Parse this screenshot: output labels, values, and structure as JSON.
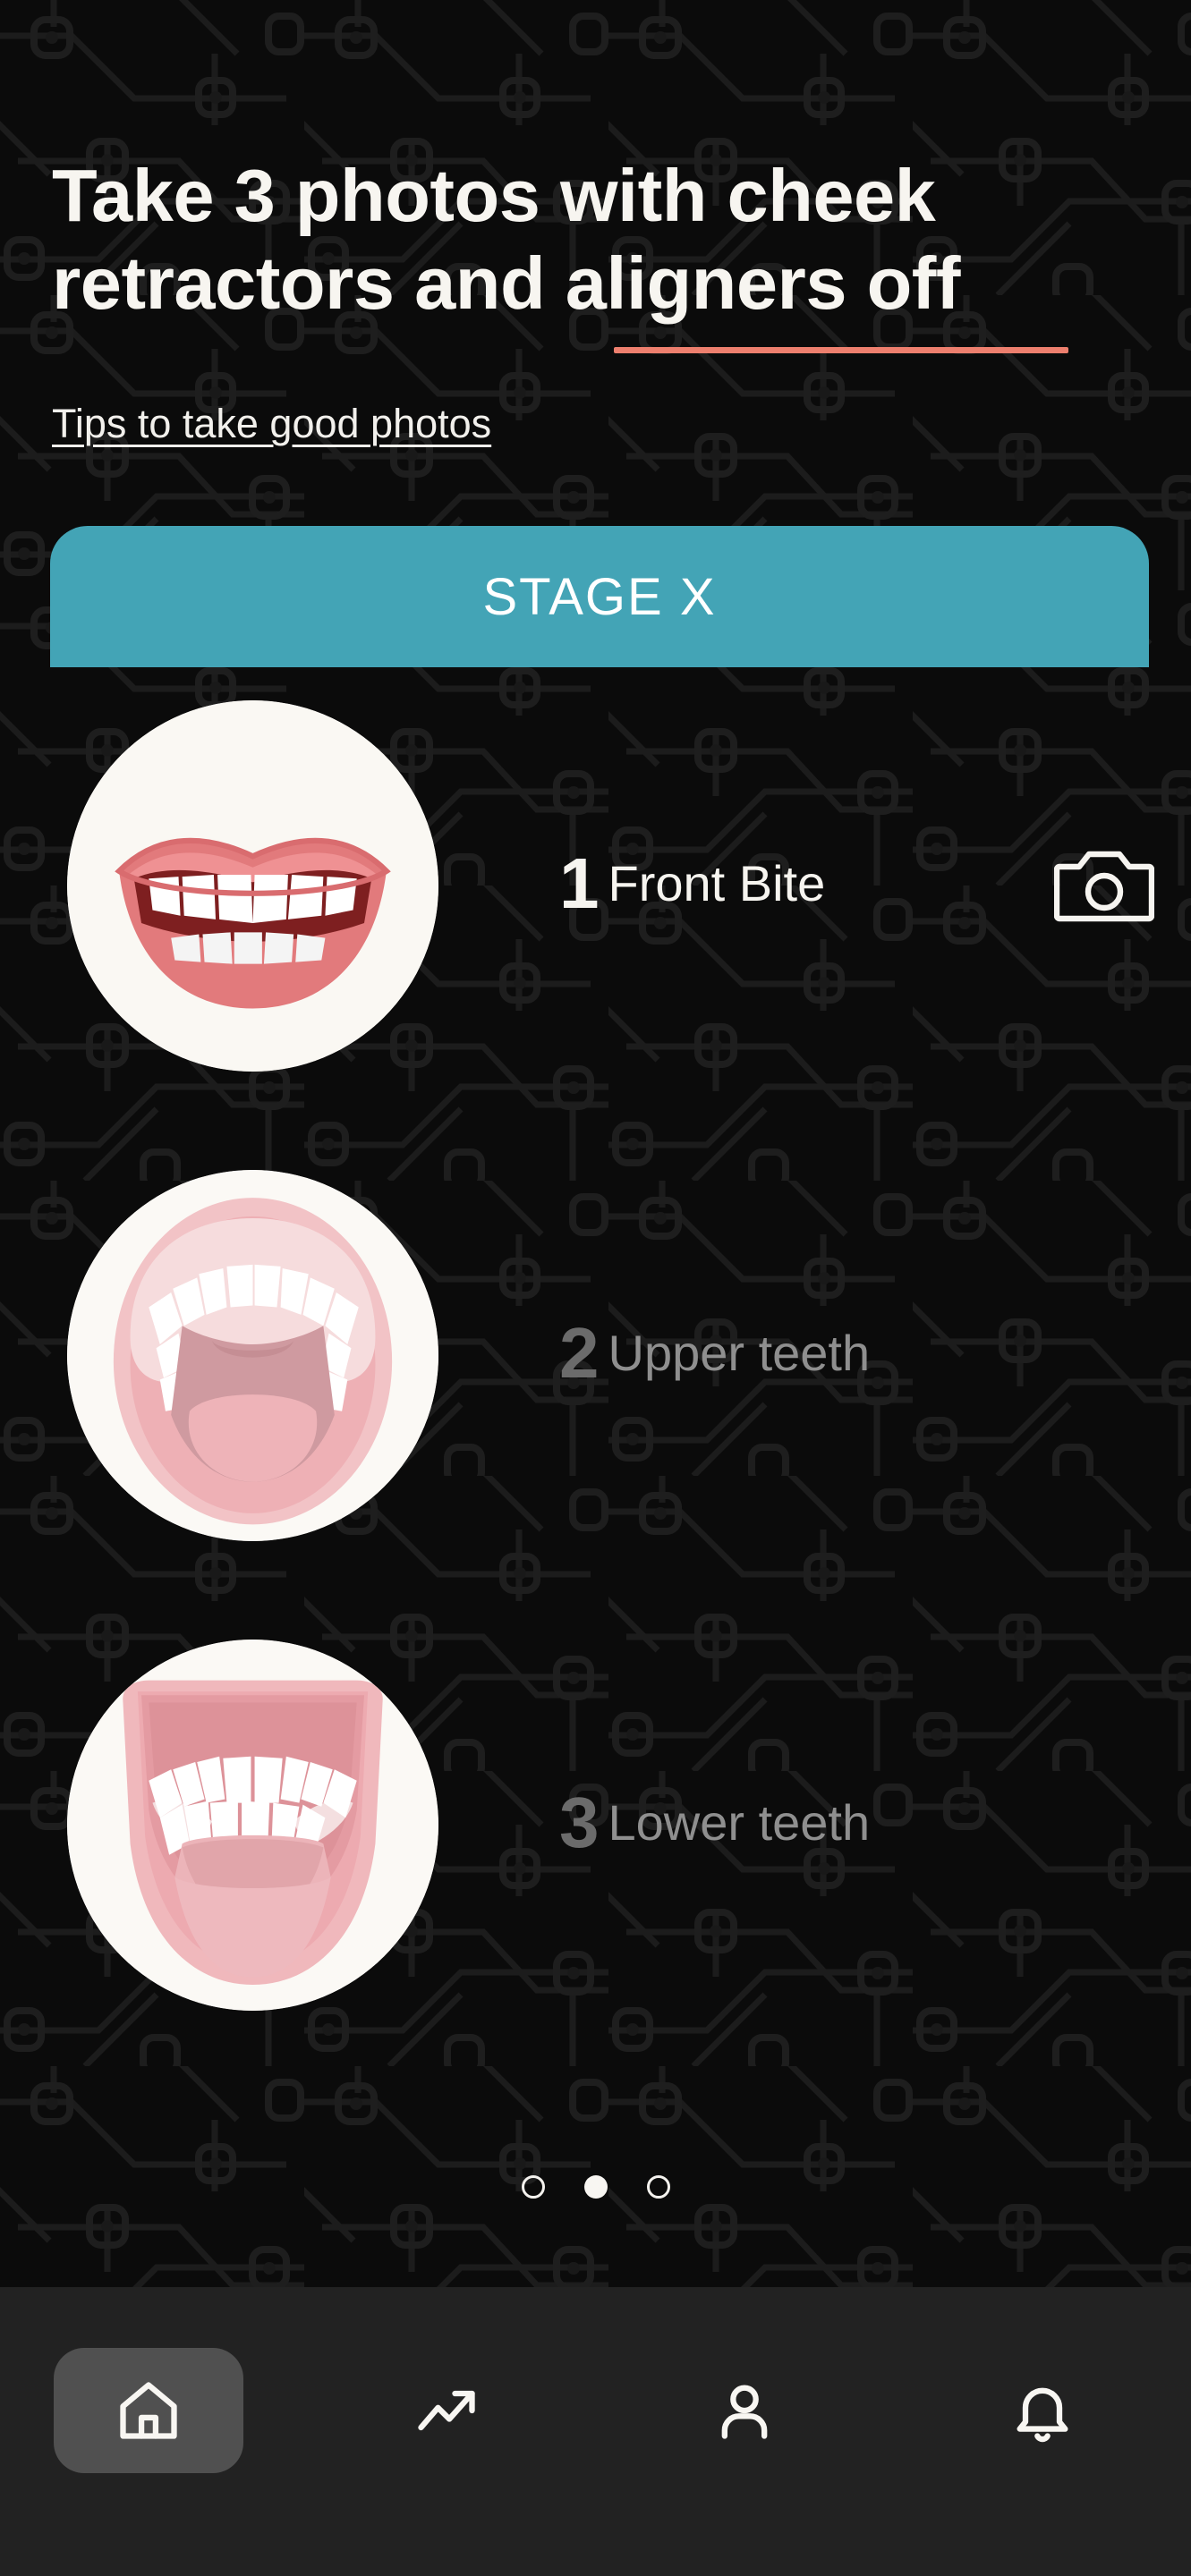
{
  "header": {
    "title": "Take 3 photos with cheek retractors and aligners off",
    "underline_color": "#ed7f6e",
    "tips_link": "Tips to take good photos"
  },
  "stage_banner": {
    "label": "STAGE X",
    "color": "#43a4b6"
  },
  "photo_steps": [
    {
      "number": "1",
      "label": "Front Bite",
      "state": "active",
      "icon": "camera-icon",
      "thumb": "smiling-mouth-front-bite"
    },
    {
      "number": "2",
      "label": "Upper teeth",
      "state": "inactive",
      "icon": "",
      "thumb": "open-mouth-upper-teeth"
    },
    {
      "number": "3",
      "label": "Lower teeth",
      "state": "inactive",
      "icon": "",
      "thumb": "open-mouth-lower-teeth"
    }
  ],
  "pagination": {
    "total": 3,
    "active_index": 1
  },
  "bottom_nav": {
    "items": [
      {
        "icon": "home-icon",
        "active": true
      },
      {
        "icon": "trending-up-icon",
        "active": false
      },
      {
        "icon": "person-icon",
        "active": false
      },
      {
        "icon": "bell-icon",
        "active": false
      }
    ]
  },
  "colors": {
    "background": "#0b0b0b",
    "nav_background": "#222222",
    "accent_teal": "#43a4b6",
    "accent_coral": "#ed7f6e",
    "text_primary": "#f7f5f0",
    "text_muted": "#8f8f8f"
  }
}
